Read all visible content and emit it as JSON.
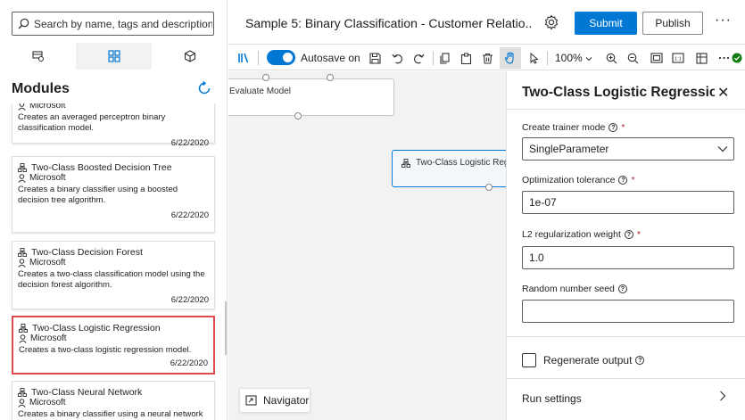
{
  "search": {
    "placeholder": "Search by name, tags and description"
  },
  "left_panel": {
    "title": "Modules",
    "tabs": [
      {
        "icon": "data-icon"
      },
      {
        "icon": "modules-icon"
      },
      {
        "icon": "package-icon"
      }
    ]
  },
  "modules": [
    {
      "name": "",
      "publisher": "Microsoft",
      "description": "Creates an averaged perceptron binary classification model.",
      "date": "6/22/2020"
    },
    {
      "name": "Two-Class Boosted Decision Tree",
      "publisher": "Microsoft",
      "description": "Creates a binary classifier using a boosted decision tree algorithm.",
      "date": "6/22/2020"
    },
    {
      "name": "Two-Class Decision Forest",
      "publisher": "Microsoft",
      "description": "Creates a two-class classification model using the decision forest algorithm.",
      "date": "6/22/2020"
    },
    {
      "name": "Two-Class Logistic Regression",
      "publisher": "Microsoft",
      "description": "Creates a two-class logistic regression model.",
      "date": "6/22/2020",
      "selected": true
    },
    {
      "name": "Two-Class Neural Network",
      "publisher": "Microsoft",
      "description": "Creates a binary classifier using a neural network",
      "date": ""
    }
  ],
  "header": {
    "title": "Sample 5: Binary Classification - Customer Relatio...",
    "submit_label": "Submit",
    "publish_label": "Publish",
    "more_label": "···"
  },
  "toolbar": {
    "autosave_label": "Autosave on",
    "autosave_on": true,
    "zoom_label": "100%"
  },
  "canvas": {
    "nodes": [
      {
        "label": "Evaluate Model"
      },
      {
        "label": "Two-Class Logistic Regr"
      }
    ],
    "navigator_label": "Navigator"
  },
  "properties": {
    "title": "Two-Class Logistic Regressio...",
    "close_label": "✕",
    "fields": [
      {
        "label": "Create trainer mode",
        "required": true,
        "value": "SingleParameter",
        "type": "select"
      },
      {
        "label": "Optimization tolerance",
        "required": true,
        "value": "1e-07",
        "type": "text"
      },
      {
        "label": "L2 regularization weight",
        "required": true,
        "value": "1.0",
        "type": "text"
      },
      {
        "label": "Random number seed",
        "required": false,
        "value": "",
        "type": "text"
      }
    ],
    "regenerate_label": "Regenerate output",
    "regenerate_checked": false,
    "run_settings_label": "Run settings"
  }
}
